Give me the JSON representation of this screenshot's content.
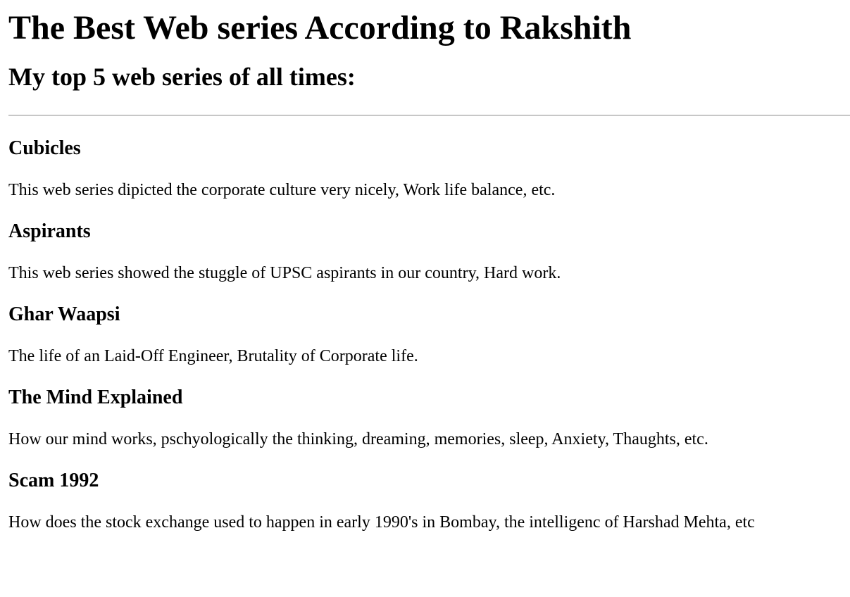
{
  "page": {
    "title": "The Best Web series According to Rakshith",
    "subtitle": "My top 5 web series of all times:"
  },
  "series": [
    {
      "title": "Cubicles",
      "description": "This web series dipicted the corporate culture very nicely, Work life balance, etc."
    },
    {
      "title": "Aspirants",
      "description": "This web series showed the stuggle of UPSC aspirants in our country, Hard work."
    },
    {
      "title": "Ghar Waapsi",
      "description": "The life of an Laid-Off Engineer, Brutality of Corporate life."
    },
    {
      "title": "The Mind Explained",
      "description": "How our mind works, pschyologically the thinking, dreaming, memories, sleep, Anxiety, Thaughts, etc."
    },
    {
      "title": "Scam 1992",
      "description": "How does the stock exchange used to happen in early 1990's in Bombay, the intelligenc of Harshad Mehta, etc"
    }
  ]
}
